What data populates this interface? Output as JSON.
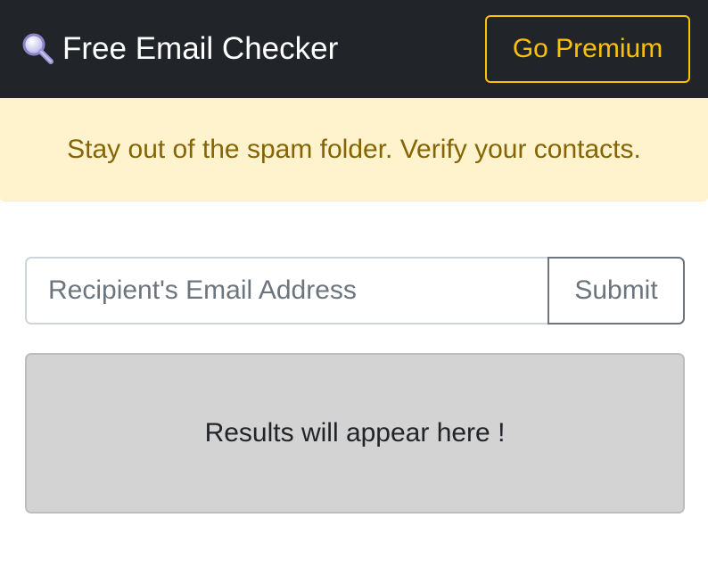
{
  "navbar": {
    "brand_icon": "magnifier-icon",
    "brand_title": "Free Email Checker",
    "premium_label": "Go Premium"
  },
  "alert": {
    "message": "Stay out of the spam folder. Verify your contacts."
  },
  "form": {
    "email_value": "",
    "email_placeholder": "Recipient's Email Address",
    "submit_label": "Submit"
  },
  "results": {
    "message": "Results will appear here !"
  },
  "colors": {
    "navbar_bg": "#212529",
    "accent_warning": "#ffc107",
    "alert_bg": "#fff3cd",
    "alert_text": "#856404",
    "results_bg": "#d3d3d3",
    "secondary": "#6c757d"
  }
}
